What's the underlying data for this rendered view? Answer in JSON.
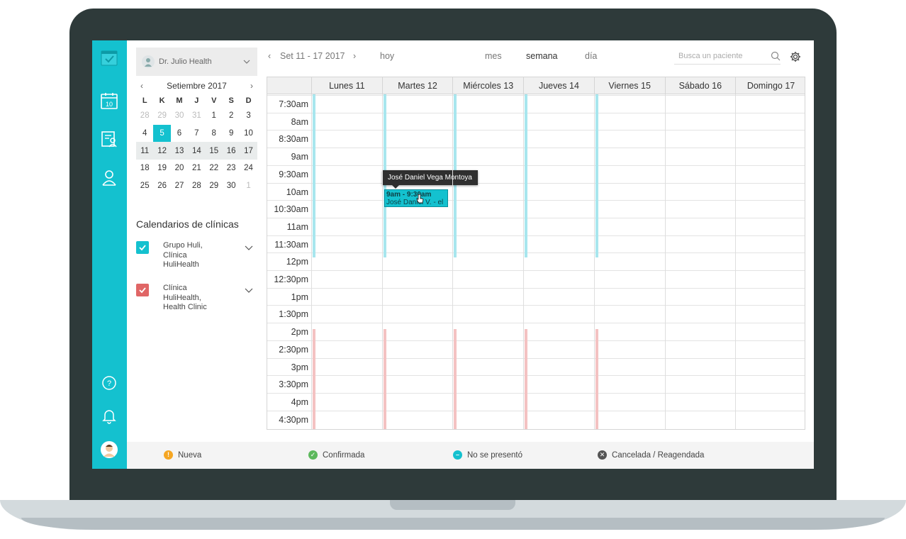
{
  "doctor": {
    "name": "Dr. Julio Health"
  },
  "mini_calendar": {
    "month_label": "Setiembre 2017",
    "weekdays": [
      "L",
      "K",
      "M",
      "J",
      "V",
      "S",
      "D"
    ],
    "weeks": [
      [
        "28",
        "29",
        "30",
        "31",
        "1",
        "2",
        "3"
      ],
      [
        "4",
        "5",
        "6",
        "7",
        "8",
        "9",
        "10"
      ],
      [
        "11",
        "12",
        "13",
        "14",
        "15",
        "16",
        "17"
      ],
      [
        "18",
        "19",
        "20",
        "21",
        "22",
        "23",
        "24"
      ],
      [
        "25",
        "26",
        "27",
        "28",
        "29",
        "30",
        "1"
      ]
    ],
    "today": "5",
    "selected_week_index": 2
  },
  "clinics": {
    "title": "Calendarios de clínicas",
    "items": [
      {
        "name_lines": [
          "Grupo Huli,",
          "Clínica",
          "HuliHealth"
        ],
        "color": "#14c1cf"
      },
      {
        "name_lines": [
          "Clínica",
          "HuliHealth,",
          "Health Clinic"
        ],
        "color": "#e06666"
      }
    ]
  },
  "toolbar": {
    "date_range": "Set 11 - 17 2017",
    "today_label": "hoy",
    "views": [
      "mes",
      "semana",
      "día"
    ],
    "active_view": "semana",
    "search_placeholder": "Busca un paciente"
  },
  "week": {
    "days": [
      "Lunes 11",
      "Martes 12",
      "Miércoles 13",
      "Jueves 14",
      "Viernes 15",
      "Sábado 16",
      "Domingo 17"
    ],
    "times": [
      "7:30am",
      "8am",
      "8:30am",
      "9am",
      "9:30am",
      "10am",
      "10:30am",
      "11am",
      "11:30am",
      "12pm",
      "12:30pm",
      "1pm",
      "1:30pm",
      "2pm",
      "2:30pm",
      "3pm",
      "3:30pm",
      "4pm",
      "4:30pm"
    ]
  },
  "appointment": {
    "time": "9am - 9:30am",
    "label": "José Daniel V. - el",
    "tooltip": "José Daniel Vega Montoya"
  },
  "legend": [
    {
      "label": "Nueva",
      "color": "#f5a623",
      "icon": "exclamation-icon"
    },
    {
      "label": "Confirmada",
      "color": "#5cb85c",
      "icon": "check-icon"
    },
    {
      "label": "No se presentó",
      "color": "#14c1cf",
      "icon": "minus-icon"
    },
    {
      "label": "Cancelada / Reagendada",
      "color": "#555555",
      "icon": "x-icon"
    }
  ],
  "colors": {
    "accent": "#14c1cf",
    "morning_availability": "#a8e6ee",
    "afternoon_availability": "#f4c2c2"
  }
}
